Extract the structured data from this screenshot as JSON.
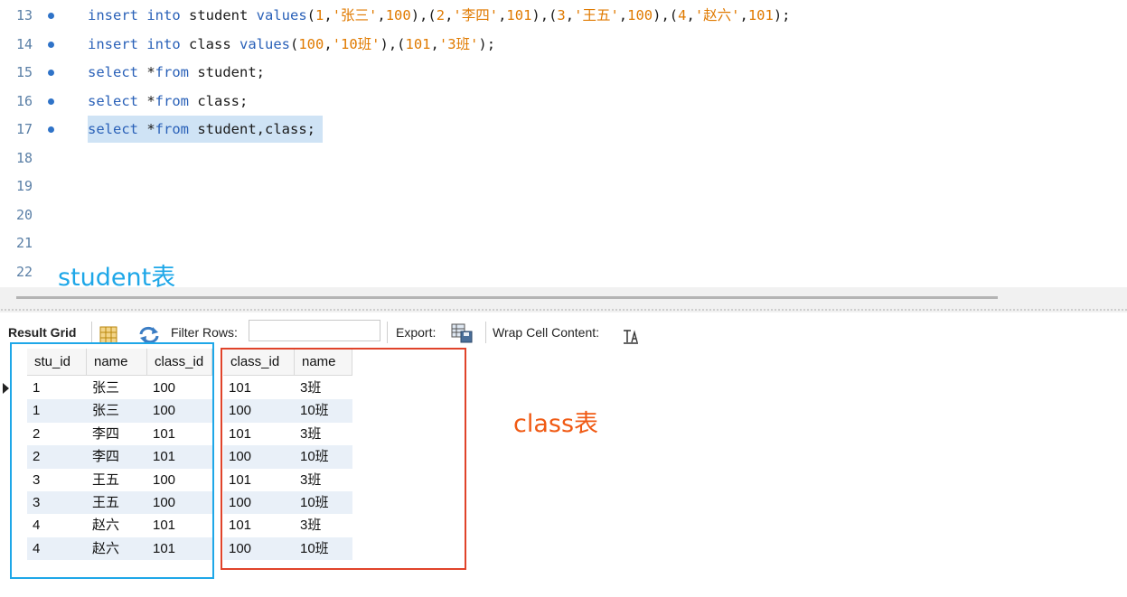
{
  "editor": {
    "lines": [
      {
        "num": "13",
        "has_dot": true,
        "tokens": [
          {
            "t": "insert",
            "c": "kw"
          },
          {
            "t": " "
          },
          {
            "t": "into",
            "c": "kw"
          },
          {
            "t": " student "
          },
          {
            "t": "values",
            "c": "kw"
          },
          {
            "t": "("
          },
          {
            "t": "1",
            "c": "num"
          },
          {
            "t": ","
          },
          {
            "t": "'张三'",
            "c": "str"
          },
          {
            "t": ","
          },
          {
            "t": "100",
            "c": "num"
          },
          {
            "t": "),("
          },
          {
            "t": "2",
            "c": "num"
          },
          {
            "t": ","
          },
          {
            "t": "'李四'",
            "c": "str"
          },
          {
            "t": ","
          },
          {
            "t": "101",
            "c": "num"
          },
          {
            "t": "),("
          },
          {
            "t": "3",
            "c": "num"
          },
          {
            "t": ","
          },
          {
            "t": "'王五'",
            "c": "str"
          },
          {
            "t": ","
          },
          {
            "t": "100",
            "c": "num"
          },
          {
            "t": "),("
          },
          {
            "t": "4",
            "c": "num"
          },
          {
            "t": ","
          },
          {
            "t": "'赵六'",
            "c": "str"
          },
          {
            "t": ","
          },
          {
            "t": "101",
            "c": "num"
          },
          {
            "t": ");"
          }
        ]
      },
      {
        "num": "14",
        "has_dot": true,
        "tokens": [
          {
            "t": "insert",
            "c": "kw"
          },
          {
            "t": " "
          },
          {
            "t": "into",
            "c": "kw"
          },
          {
            "t": " class "
          },
          {
            "t": "values",
            "c": "kw"
          },
          {
            "t": "("
          },
          {
            "t": "100",
            "c": "num"
          },
          {
            "t": ","
          },
          {
            "t": "'10班'",
            "c": "str"
          },
          {
            "t": "),("
          },
          {
            "t": "101",
            "c": "num"
          },
          {
            "t": ","
          },
          {
            "t": "'3班'",
            "c": "str"
          },
          {
            "t": ");"
          }
        ]
      },
      {
        "num": "15",
        "has_dot": true,
        "tokens": [
          {
            "t": "select",
            "c": "kw"
          },
          {
            "t": " *"
          },
          {
            "t": "from",
            "c": "kw"
          },
          {
            "t": " student;"
          }
        ]
      },
      {
        "num": "16",
        "has_dot": true,
        "tokens": [
          {
            "t": "select",
            "c": "kw"
          },
          {
            "t": " *"
          },
          {
            "t": "from",
            "c": "kw"
          },
          {
            "t": " class;"
          }
        ]
      },
      {
        "num": "17",
        "has_dot": true,
        "selected": true,
        "tokens": [
          {
            "t": "select",
            "c": "kw"
          },
          {
            "t": " *"
          },
          {
            "t": "from",
            "c": "kw"
          },
          {
            "t": " student,class;"
          }
        ]
      },
      {
        "num": "18",
        "has_dot": false,
        "tokens": []
      },
      {
        "num": "19",
        "has_dot": false,
        "tokens": []
      },
      {
        "num": "20",
        "has_dot": false,
        "tokens": []
      },
      {
        "num": "21",
        "has_dot": false,
        "tokens": []
      },
      {
        "num": "22",
        "has_dot": false,
        "tokens": []
      }
    ]
  },
  "annotations": {
    "student_label": "student表",
    "class_label": "class表",
    "student_color": "#1ea7e8",
    "class_color": "#e0432a"
  },
  "toolbar": {
    "result_grid_label": "Result Grid",
    "filter_rows_label": "Filter Rows:",
    "filter_rows_value": "",
    "export_label": "Export:",
    "wrap_cell_label": "Wrap Cell Content:",
    "icons": [
      "grid-view-icon",
      "refresh-icon",
      "export-icon",
      "wrap-text-icon"
    ]
  },
  "grid": {
    "columns": [
      "stu_id",
      "name",
      "class_id",
      "class_id",
      "name"
    ],
    "rows": [
      [
        "1",
        "张三",
        "100",
        "101",
        "3班"
      ],
      [
        "1",
        "张三",
        "100",
        "100",
        "10班"
      ],
      [
        "2",
        "李四",
        "101",
        "101",
        "3班"
      ],
      [
        "2",
        "李四",
        "101",
        "100",
        "10班"
      ],
      [
        "3",
        "王五",
        "100",
        "101",
        "3班"
      ],
      [
        "3",
        "王五",
        "100",
        "100",
        "10班"
      ],
      [
        "4",
        "赵六",
        "101",
        "101",
        "3班"
      ],
      [
        "4",
        "赵六",
        "101",
        "100",
        "10班"
      ]
    ]
  }
}
